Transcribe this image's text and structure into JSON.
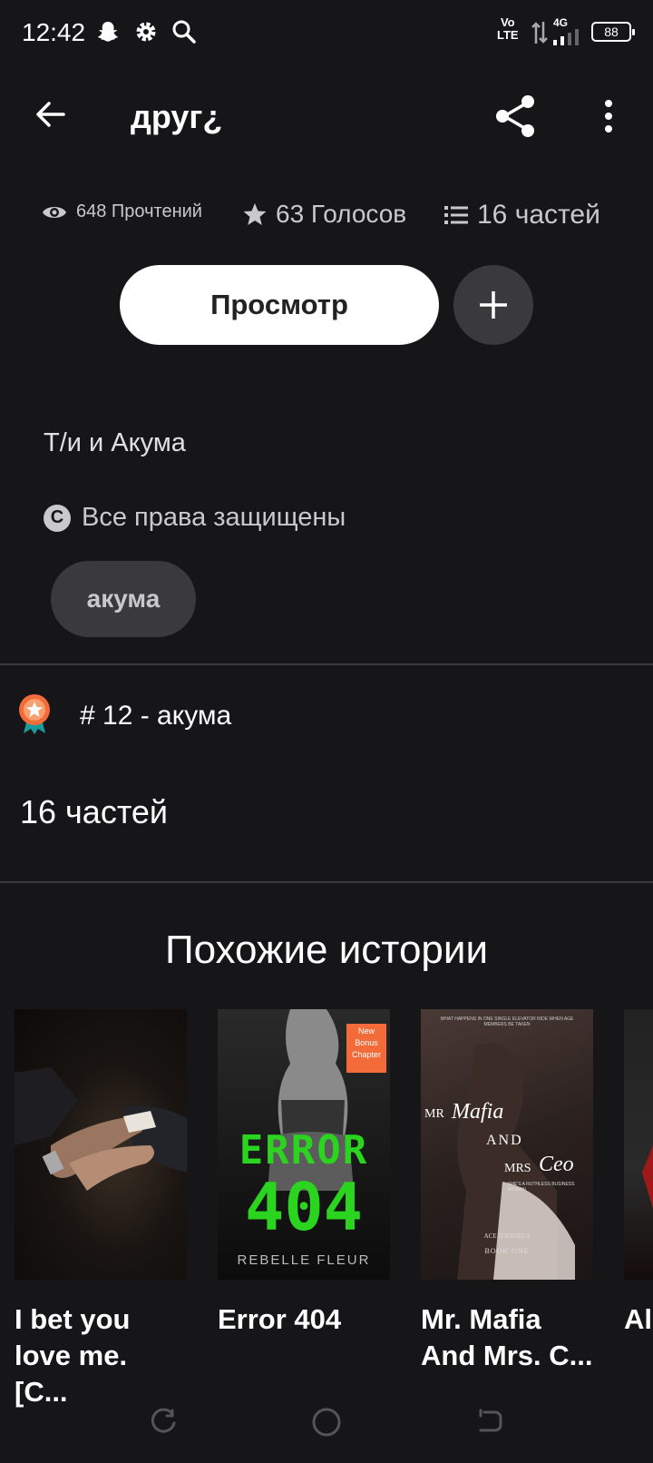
{
  "status_bar": {
    "time": "12:42",
    "volte": "Vo\nLTE",
    "network": "4G",
    "battery": "88"
  },
  "toolbar": {
    "title": "друг¿"
  },
  "stats": {
    "reads": "648 Прочтений",
    "votes": "63 Голосов",
    "parts": "16 частей"
  },
  "actions": {
    "read_label": "Просмотр"
  },
  "description": "Т/и и Акума",
  "copyright": "Все права защищены",
  "tags": [
    "акума"
  ],
  "rank": "# 12 - акума",
  "parts_count": "16 частей",
  "similar": {
    "heading": "Похожие истории",
    "stories": [
      {
        "title": "I bet you\nlove me. [C..."
      },
      {
        "title": "Error 404",
        "cover_text": {
          "badge": "New\nBonus\nChapter",
          "line1": "ERROR",
          "line2": "404",
          "author": "REBELLE FLEUR"
        }
      },
      {
        "title": "Mr. Mafia\nAnd Mrs. C...",
        "cover_text": {
          "tagline": "WHAT HAPPENS IN ONE SINGLE ELEVATOR RIDE WHEN AGE MEMBERS BE TAKEN",
          "mr": "MR",
          "mafia": "Mafia",
          "and": "AND",
          "mrs": "MRS",
          "ceo": "Ceo",
          "sub": "SHE'S A RUTHLESS BUSINESS WOMAN",
          "author": "ACE D'ANGELO",
          "book": "BOOK ONE"
        }
      },
      {
        "title": "Al"
      }
    ]
  },
  "colors": {
    "background": "#161518",
    "accent_orange": "#f26b38",
    "teal": "#1a9b9b"
  }
}
